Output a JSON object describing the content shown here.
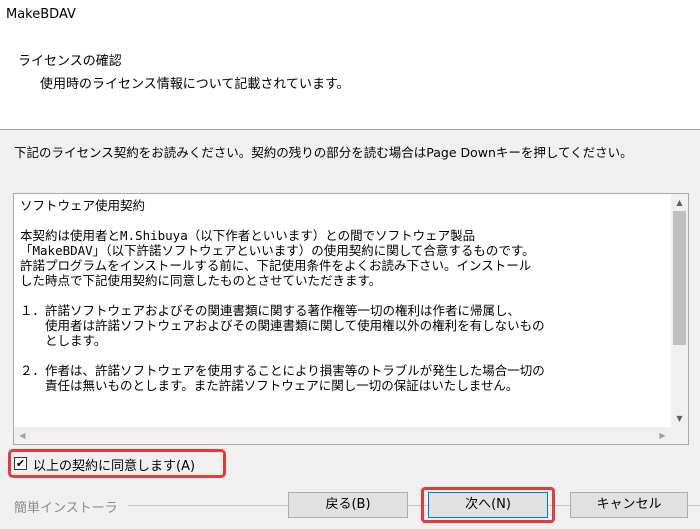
{
  "window": {
    "title": "MakeBDAV"
  },
  "header": {
    "title": "ライセンスの確認",
    "subtitle": "使用時のライセンス情報について記載されています。"
  },
  "instruction": "下記のライセンス契約をお読みください。契約の残りの部分を読む場合はPage Downキーを押してください。",
  "license_text": "ソフトウェア使用契約\n\n本契約は使用者とM.Shibuya（以下作者といいます）との間でソフトウェア製品\n「MakeBDAV」（以下許諾ソフトウェアといいます）の使用契約に関して合意するものです。\n許諾プログラムをインストールする前に、下記使用条件をよくお読み下さい。インストール\nした時点で下記使用契約に同意したものとさせていただきます。\n\n１．許諾ソフトウェアおよびその関連書類に関する著作権等一切の権利は作者に帰属し、\n　　使用者は許諾ソフトウェアおよびその関連書類に関して使用権以外の権利を有しないもの\n　　とします。\n\n２．作者は、許諾ソフトウェアを使用することにより損害等のトラブルが発生した場合一切の\n　　責任は無いものとします。また許諾ソフトウェアに関し一切の保証はいたしません。",
  "agreement": {
    "label": "以上の契約に同意します(A)",
    "checked": true
  },
  "footer": {
    "brand": "簡単インストーラ",
    "back_label": "戻る(B)",
    "next_label": "次へ(N)",
    "cancel_label": "キャンセル"
  },
  "colors": {
    "highlight": "#e53a3a",
    "focus": "#0078d7"
  },
  "icons": {
    "scroll_up": "chevron-up-icon",
    "scroll_down": "chevron-down-icon",
    "scroll_left": "chevron-left-icon",
    "scroll_right": "chevron-right-icon",
    "checkmark": "checkmark-icon"
  }
}
